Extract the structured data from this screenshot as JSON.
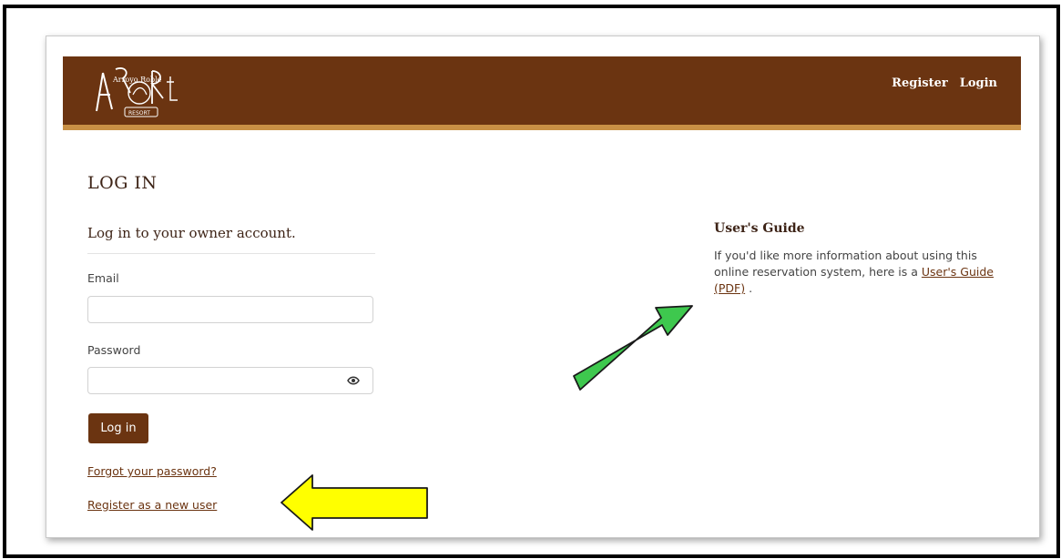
{
  "nav": {
    "register": "Register",
    "login": "Login"
  },
  "logo": {
    "name": "logo-icon",
    "text": "Arroyo Roble",
    "badge": "RESORT"
  },
  "login": {
    "page_title": "LOG IN",
    "subtitle": "Log in to your owner account.",
    "email_label": "Email",
    "email_value": "",
    "password_label": "Password",
    "password_value": "",
    "button_label": "Log in",
    "forgot_link": "Forgot your password?",
    "register_link": "Register as a new user"
  },
  "guide": {
    "title": "User's Guide",
    "text": "If you'd like more information about using this online reservation system, here is a ",
    "link": "User's Guide (PDF)",
    "suffix": " ."
  },
  "annotations": {
    "green_arrow_color": "#3ec84e",
    "yellow_arrow_color": "#ffff00"
  },
  "colors": {
    "brand_brown": "#6b3411",
    "accent_gold": "#c99045"
  }
}
